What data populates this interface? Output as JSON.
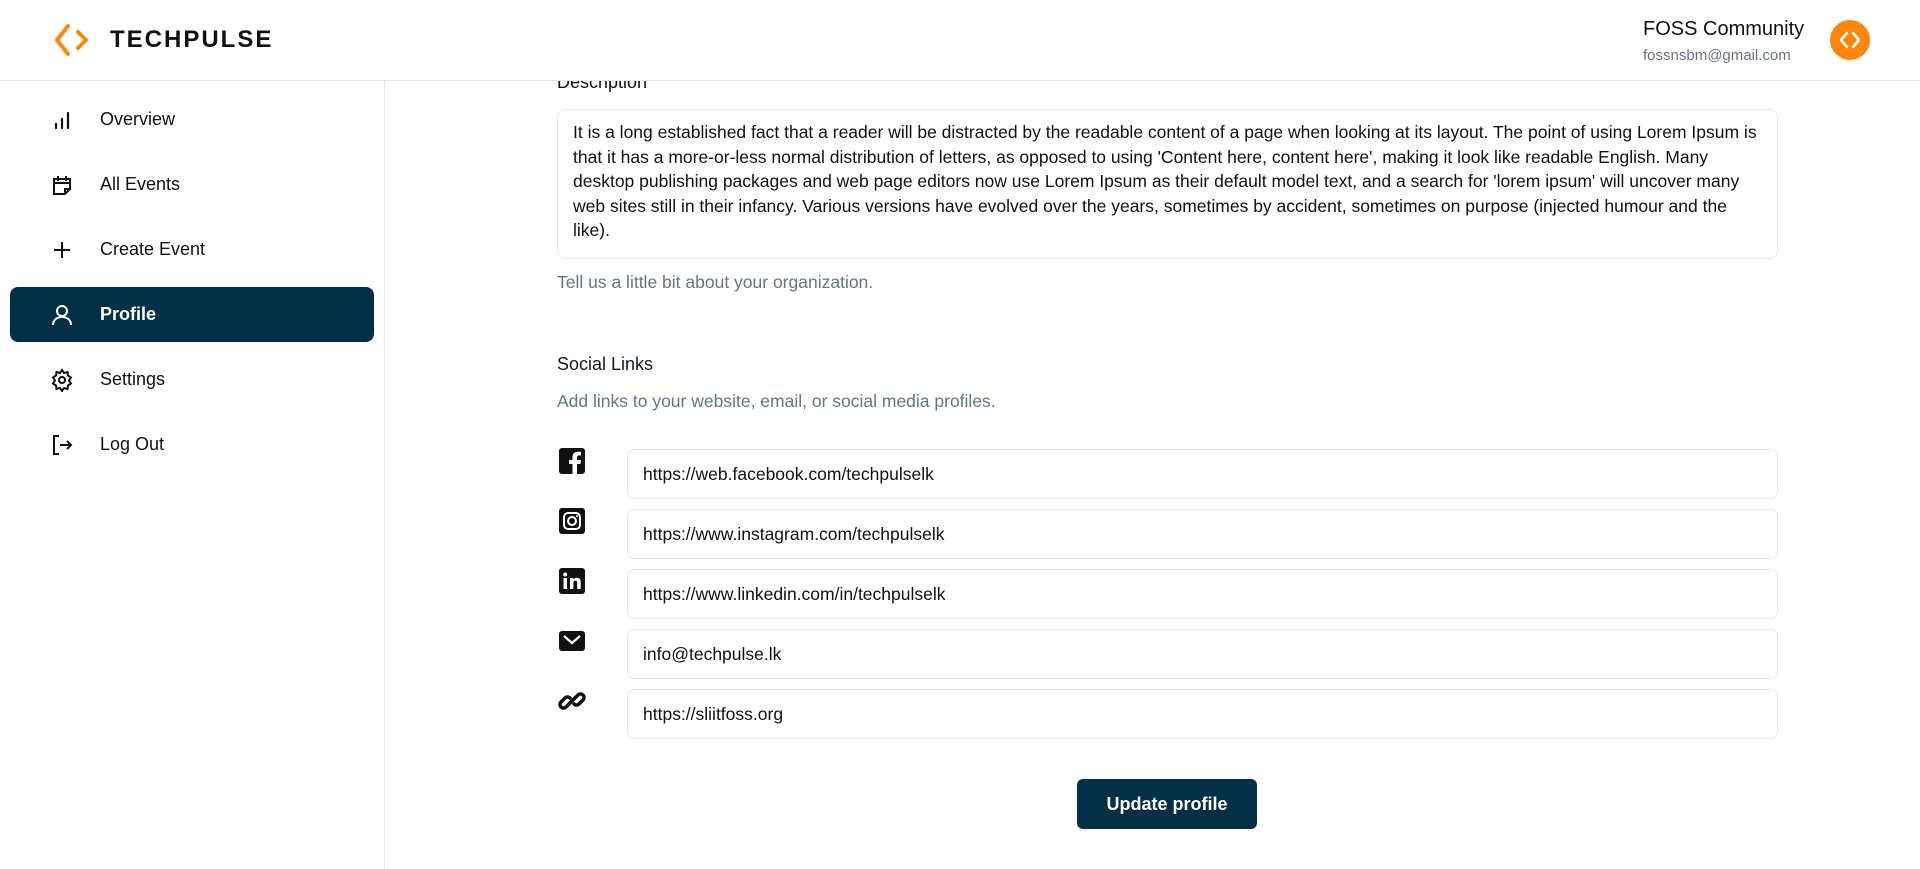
{
  "brand": {
    "name": "TECHPULSE",
    "accent": "#f7870f",
    "primary": "#033047"
  },
  "user": {
    "name": "FOSS Community",
    "email": "fossnsbm@gmail.com"
  },
  "sidebar": {
    "items": [
      {
        "label": "Overview",
        "icon": "bar-chart-icon"
      },
      {
        "label": "All Events",
        "icon": "calendar-icon"
      },
      {
        "label": "Create Event",
        "icon": "plus-icon"
      },
      {
        "label": "Profile",
        "icon": "user-icon",
        "active": true
      },
      {
        "label": "Settings",
        "icon": "gear-icon"
      },
      {
        "label": "Log Out",
        "icon": "logout-icon"
      }
    ]
  },
  "description": {
    "label": "Description",
    "value": "It is a long established fact that a reader will be distracted by the readable content of a page when looking at its layout. The point of using Lorem Ipsum is that it has a more-or-less normal distribution of letters, as opposed to using 'Content here, content here', making it look like readable English. Many desktop publishing packages and web page editors now use Lorem Ipsum as their default model text, and a search for 'lorem ipsum' will uncover many web sites still in their infancy. Various versions have evolved over the years, sometimes by accident, sometimes on purpose (injected humour and the like).",
    "hint": "Tell us a little bit about your organization."
  },
  "social": {
    "title": "Social Links",
    "hint": "Add links to your website, email, or social media profiles.",
    "links": [
      {
        "icon": "facebook-icon",
        "value": "https://web.facebook.com/techpulselk"
      },
      {
        "icon": "instagram-icon",
        "value": "https://www.instagram.com/techpulselk"
      },
      {
        "icon": "linkedin-icon",
        "value": "https://www.linkedin.com/in/techpulselk"
      },
      {
        "icon": "mail-icon",
        "value": "info@techpulse.lk"
      },
      {
        "icon": "link-icon",
        "value": "https://sliitfoss.org"
      }
    ]
  },
  "update_label": "Update profile"
}
